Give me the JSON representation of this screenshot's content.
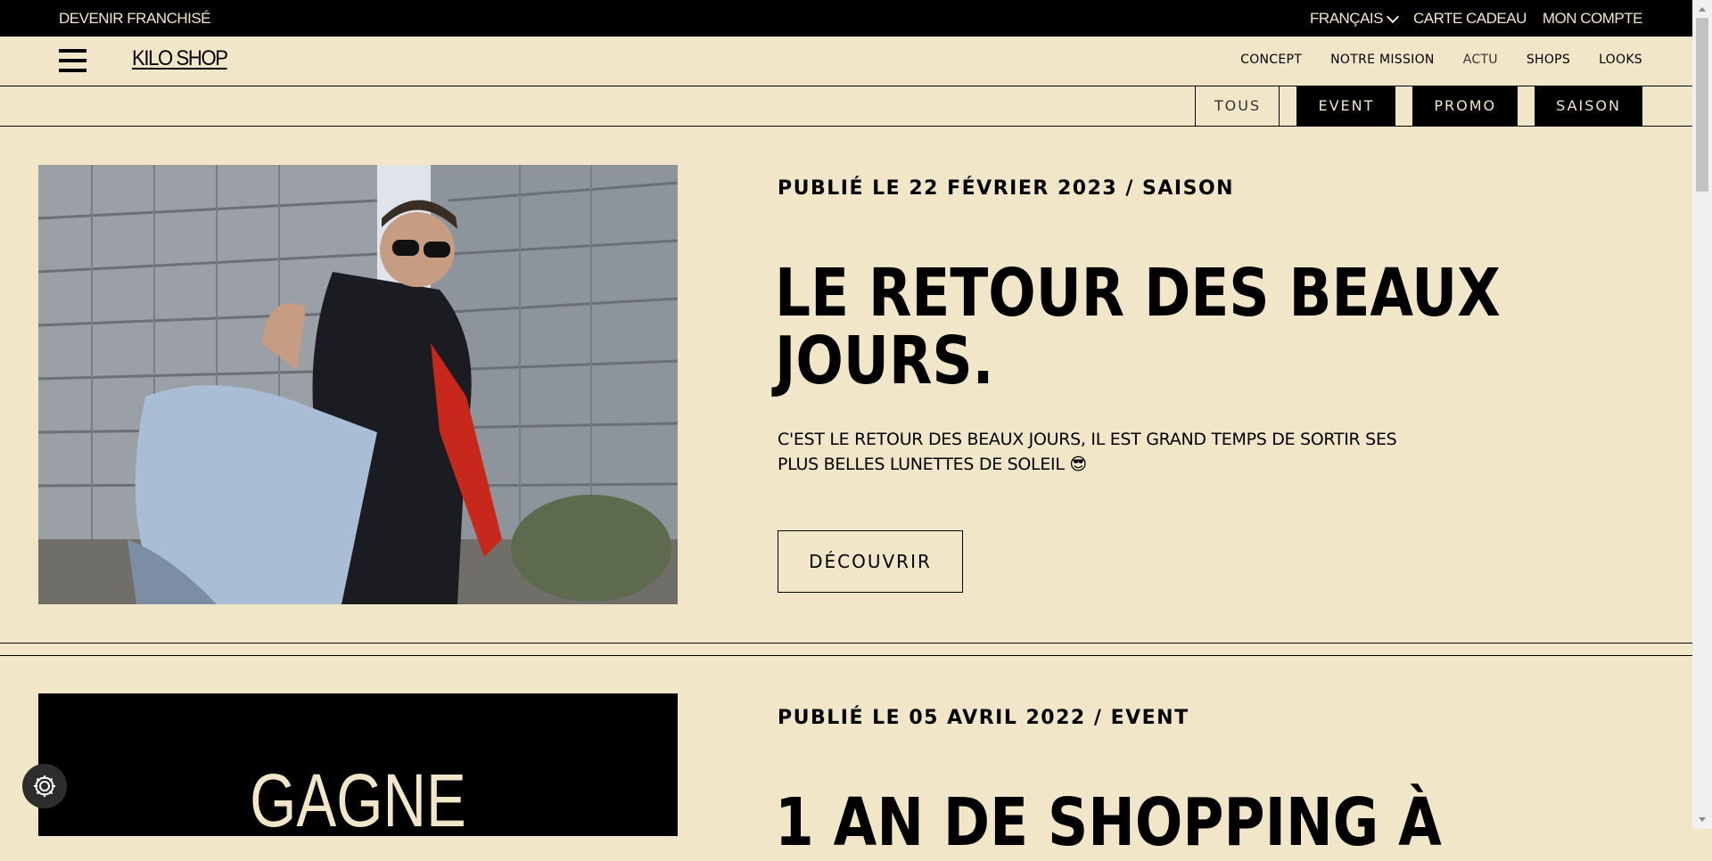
{
  "topbar": {
    "franchise": "DEVENIR FRANCHISÉ",
    "language": "FRANÇAIS",
    "gift_card": "CARTE CADEAU",
    "account": "MON COMPTE"
  },
  "header": {
    "logo": "KILO SHOP",
    "nav": [
      "CONCEPT",
      "NOTRE MISSION",
      "ACTU",
      "SHOPS",
      "LOOKS"
    ]
  },
  "filters": [
    "TOUS",
    "EVENT",
    "PROMO",
    "SAISON"
  ],
  "articles": [
    {
      "meta": "PUBLIÉ LE 22 FÉVRIER 2023 / SAISON",
      "title_line1": "LE RETOUR DES BEAUX",
      "title_line2": "JOURS.",
      "description_line1": "C'EST LE RETOUR DES BEAUX JOURS, IL EST GRAND TEMPS DE SORTIR SES",
      "description_line2": "PLUS BELLES LUNETTES DE SOLEIL 😎",
      "cta": "DÉCOUVRIR"
    },
    {
      "meta": "PUBLIÉ LE 05 AVRIL 2022 / EVENT",
      "title_line1": "1 AN DE SHOPPING À",
      "image_text": "GAGNE"
    }
  ],
  "colors": {
    "background": "#f1e6c8",
    "ink": "#000000",
    "cookie_button": "#2d2d2d"
  },
  "icons": [
    "hamburger-menu-icon",
    "chevron-down-icon",
    "cookie-settings-icon"
  ]
}
